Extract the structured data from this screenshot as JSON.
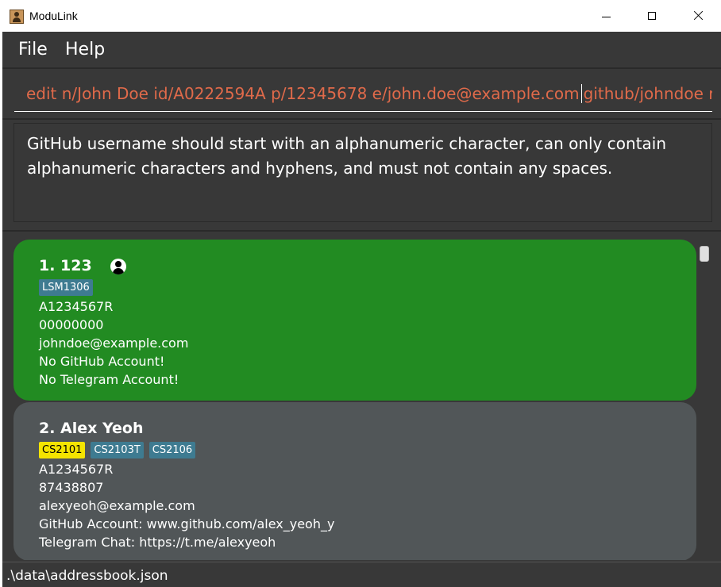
{
  "window": {
    "title": "ModuLink"
  },
  "menu": {
    "file": "File",
    "help": "Help"
  },
  "command": {
    "before_caret": "edit n/John Doe id/A0222594A p/12345678 e/john.doe@example.com",
    "after_caret": "github/johndoe r"
  },
  "result": {
    "message": "GitHub username should start with an alphanumeric character, can only contain alphanumeric characters and hyphens, and must not contain any spaces."
  },
  "persons": [
    {
      "name": "1. 123",
      "tags": [
        "LSM1306"
      ],
      "id": "A1234567R",
      "phone": "00000000",
      "email": "johndoe@example.com",
      "github": "No GitHub Account!",
      "telegram": "No Telegram Account!",
      "card_color": "#228B22"
    },
    {
      "name": "2. Alex Yeoh",
      "tags": [
        "CS2101",
        "CS2103T",
        "CS2106"
      ],
      "id": "A1234567R",
      "phone": "87438807",
      "email": "alexyeoh@example.com",
      "github": "GitHub Account: www.github.com/alex_yeoh_y",
      "telegram": "Telegram Chat: https://t.me/alexyeoh",
      "card_color": "#515658"
    }
  ],
  "status": {
    "path": ".\\data\\addressbook.json"
  },
  "colors": {
    "background": "#383838",
    "command_text": "#e06a4a",
    "tag": "#3e7b91",
    "tag_highlight": "#f5e400"
  }
}
